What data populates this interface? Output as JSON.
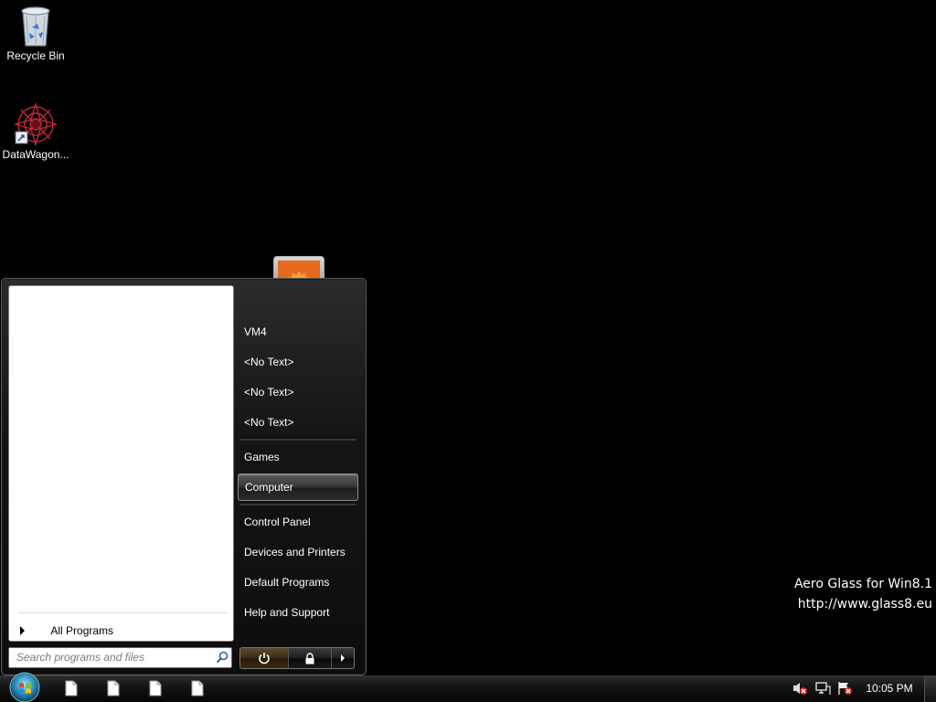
{
  "desktop": {
    "icons": [
      {
        "label": "Recycle Bin",
        "icon": "recycle-bin-icon"
      },
      {
        "label": "DataWagon...",
        "icon": "datawagon-shortcut-icon"
      }
    ]
  },
  "start_menu": {
    "all_programs_label": "All Programs",
    "search_placeholder": "Search programs and files",
    "right_items": [
      {
        "label": "VM4"
      },
      {
        "label": "<No Text>"
      },
      {
        "label": "<No Text>"
      },
      {
        "label": "<No Text>"
      },
      {
        "label": "Games"
      },
      {
        "label": "Computer",
        "selected": true
      },
      {
        "label": "Control Panel"
      },
      {
        "label": "Devices and Printers"
      },
      {
        "label": "Default Programs"
      },
      {
        "label": "Help and Support"
      }
    ],
    "power_buttons": [
      "power-icon",
      "lock-icon",
      "arrow-right-icon"
    ]
  },
  "watermark": {
    "line1": "Aero Glass for Win8.1",
    "line2": "http://www.glass8.eu"
  },
  "taskbar": {
    "start_orb_icon": "windows-orb-icon",
    "task_buttons": [
      "document-icon",
      "document-icon",
      "document-icon",
      "document-icon"
    ],
    "tray_icons": [
      "volume-muted-icon",
      "network-icon",
      "action-center-flag-icon"
    ],
    "clock": "10:05 PM"
  },
  "colors": {
    "desktop_background": "#000000",
    "menu_background": "#151515",
    "selected_item": "#3a3a3a",
    "shutdown_button": "#3a2c14"
  }
}
